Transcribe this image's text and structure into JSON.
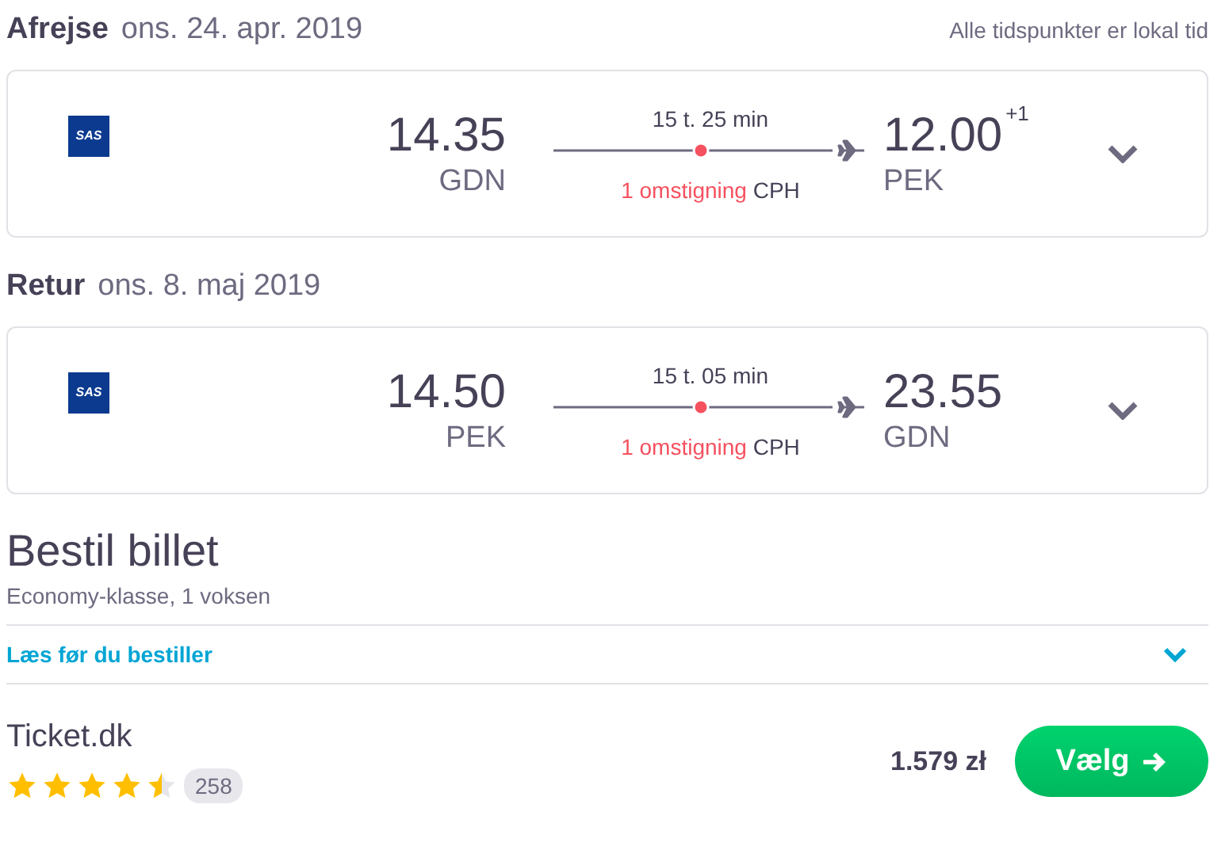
{
  "legs": [
    {
      "label": "Afrejse",
      "date": "ons. 24. apr. 2019",
      "note": "Alle tidspunkter er lokal tid",
      "logo": "SAS",
      "depart_time": "14.35",
      "depart_airport": "GDN",
      "duration": "15 t. 25 min",
      "stops": "1 omstigning",
      "via": "CPH",
      "arrive_time": "12.00",
      "day_offset": "+1",
      "arrive_airport": "PEK"
    },
    {
      "label": "Retur",
      "date": "ons. 8. maj 2019",
      "logo": "SAS",
      "depart_time": "14.50",
      "depart_airport": "PEK",
      "duration": "15 t. 05 min",
      "stops": "1 omstigning",
      "via": "CPH",
      "arrive_time": "23.55",
      "arrive_airport": "GDN"
    }
  ],
  "booking": {
    "title": "Bestil billet",
    "subtitle": "Economy-klasse, 1 voksen",
    "info_link": "Læs før du bestiller",
    "provider": "Ticket.dk",
    "stars": 4.5,
    "reviews": "258",
    "price": "1.579 zł",
    "button": "Vælg"
  }
}
